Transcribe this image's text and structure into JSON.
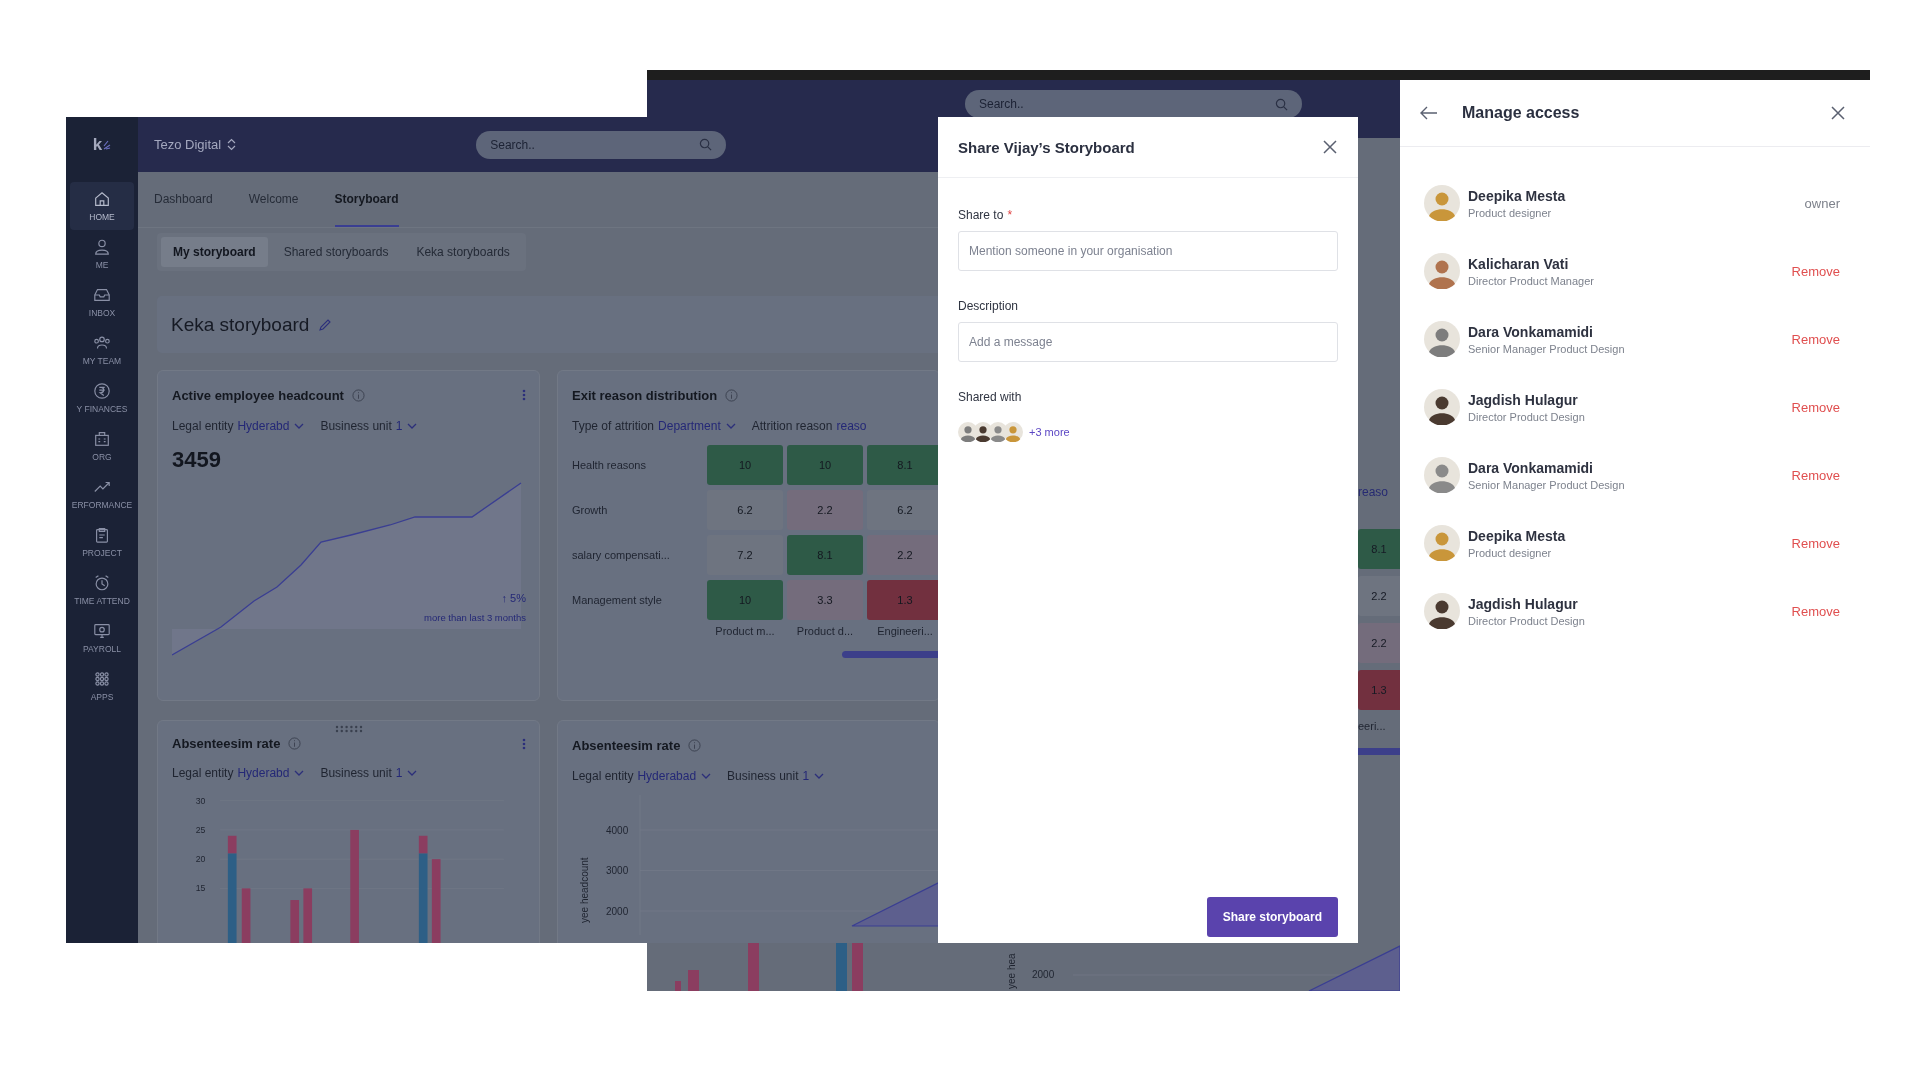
{
  "back_window": {
    "search": {
      "placeholder": "Search.."
    },
    "strip": {
      "link": "reaso",
      "cells": [
        {
          "value": "8.1",
          "color": "#2e5a47"
        },
        {
          "value": "2.2",
          "color": "#6e7480"
        },
        {
          "value": "2.2",
          "color": "#746c7c"
        },
        {
          "value": "1.3",
          "color": "#72303f"
        }
      ],
      "column_label": "eeri..."
    },
    "chart_fragment": {
      "y_tick": "2000",
      "axis_label": "yee hea"
    }
  },
  "dashboard": {
    "logo": "k",
    "org": "Tezo Digital",
    "search": {
      "placeholder": "Search.."
    },
    "sidebar": [
      {
        "label": "HOME",
        "selected": true
      },
      {
        "label": "ME",
        "selected": false
      },
      {
        "label": "INBOX",
        "selected": false
      },
      {
        "label": "MY TEAM",
        "selected": false
      },
      {
        "label": "Y FINANCES",
        "selected": false
      },
      {
        "label": "ORG",
        "selected": false
      },
      {
        "label": "ERFORMANCE",
        "selected": false
      },
      {
        "label": "PROJECT",
        "selected": false
      },
      {
        "label": "TIME ATTEND",
        "selected": false
      },
      {
        "label": "PAYROLL",
        "selected": false
      },
      {
        "label": "APPS",
        "selected": false
      }
    ],
    "tabs": [
      {
        "label": "Dashboard",
        "selected": false
      },
      {
        "label": "Welcome",
        "selected": false
      },
      {
        "label": "Storyboard",
        "selected": true
      }
    ],
    "storyboard_tabs": [
      {
        "label": "My storyboard",
        "selected": true
      },
      {
        "label": "Shared storyboards",
        "selected": false
      },
      {
        "label": "Keka storyboards",
        "selected": false
      }
    ],
    "title": "Keka storyboard",
    "cards": [
      {
        "kind": "metric",
        "title": "Active employee headcount",
        "menu": true,
        "drag_handle": false,
        "filters": [
          {
            "label": "Legal entity",
            "value": "Hyderabd",
            "dropdown": true
          },
          {
            "label": "Business unit",
            "value": "1",
            "dropdown": true
          }
        ],
        "value": "3459",
        "change": "↑ 5%",
        "change_note": "more than last 3 months"
      },
      {
        "kind": "heatmap",
        "title": "Exit reason distribution",
        "menu": false,
        "drag_handle": false,
        "filters": [
          {
            "label": "Type of attrition",
            "value": "Department",
            "dropdown": true
          },
          {
            "label": "Attrition reason",
            "value": "reaso",
            "dropdown": false
          }
        ],
        "rows": [
          {
            "label": "Health reasons",
            "cells": [
              {
                "value": "10",
                "color": "#2e5a47"
              },
              {
                "value": "10",
                "color": "#2e5a47"
              },
              {
                "value": "8.1",
                "color": "#2e5a47"
              }
            ]
          },
          {
            "label": "Growth",
            "cells": [
              {
                "value": "6.2",
                "color": "#6e7480"
              },
              {
                "value": "2.2",
                "color": "#746c7c"
              },
              {
                "value": "6.2",
                "color": "#6e7480"
              }
            ]
          },
          {
            "label": "salary compensati...",
            "cells": [
              {
                "value": "7.2",
                "color": "#6e7480"
              },
              {
                "value": "8.1",
                "color": "#2e5a47"
              },
              {
                "value": "2.2",
                "color": "#746c7c"
              }
            ]
          },
          {
            "label": "Management style",
            "cells": [
              {
                "value": "10",
                "color": "#2e5a47"
              },
              {
                "value": "3.3",
                "color": "#746c7c"
              },
              {
                "value": "1.3",
                "color": "#72303f"
              }
            ]
          }
        ],
        "footer_labels": [
          "Product m...",
          "Product d...",
          "Engineeri..."
        ]
      },
      {
        "kind": "bar_chart",
        "title": "Absenteesim rate",
        "menu": true,
        "drag_handle": true,
        "filters": [
          {
            "label": "Legal entity",
            "value": "Hyderabd",
            "dropdown": true
          },
          {
            "label": "Business unit",
            "value": "1",
            "dropdown": true
          }
        ],
        "y_ticks": [
          "30",
          "25",
          "20",
          "15"
        ]
      },
      {
        "kind": "area_chart",
        "title": "Absenteesim rate",
        "menu": false,
        "drag_handle": false,
        "filters": [
          {
            "label": "Legal entity",
            "value": "Hyderabad",
            "dropdown": true
          },
          {
            "label": "Business unit",
            "value": "1",
            "dropdown": true
          }
        ],
        "y_axis_label": "yee headcount",
        "y_ticks": [
          "4000",
          "3000",
          "2000"
        ]
      }
    ]
  },
  "share_dialog": {
    "title": "Share Vijay’s Storyboard",
    "share_to": {
      "label": "Share to",
      "required_mark": "*",
      "placeholder": "Mention someone in your organisation"
    },
    "description": {
      "label": "Description",
      "placeholder": "Add a message"
    },
    "shared_with": {
      "label": "Shared with",
      "more": "+3 more"
    },
    "submit": "Share storyboard"
  },
  "manage_access": {
    "title": "Manage access",
    "members": [
      {
        "name": "Deepika Mesta",
        "role": "Product designer",
        "kind": "owner",
        "action": "owner"
      },
      {
        "name": "Kalicharan Vati",
        "role": "Director Product Manager",
        "kind": "remove",
        "action": "Remove"
      },
      {
        "name": "Dara Vonkamamidi",
        "role": "Senior Manager Product Design",
        "kind": "remove",
        "action": "Remove"
      },
      {
        "name": "Jagdish Hulagur",
        "role": "Director Product Design",
        "kind": "remove",
        "action": "Remove"
      },
      {
        "name": "Dara Vonkamamidi",
        "role": "Senior Manager Product Design",
        "kind": "remove",
        "action": "Remove"
      },
      {
        "name": "Deepika Mesta",
        "role": "Product designer",
        "kind": "remove",
        "action": "Remove"
      },
      {
        "name": "Jagdish Hulagur",
        "role": "Director Product Design",
        "kind": "remove",
        "action": "Remove"
      }
    ]
  }
}
